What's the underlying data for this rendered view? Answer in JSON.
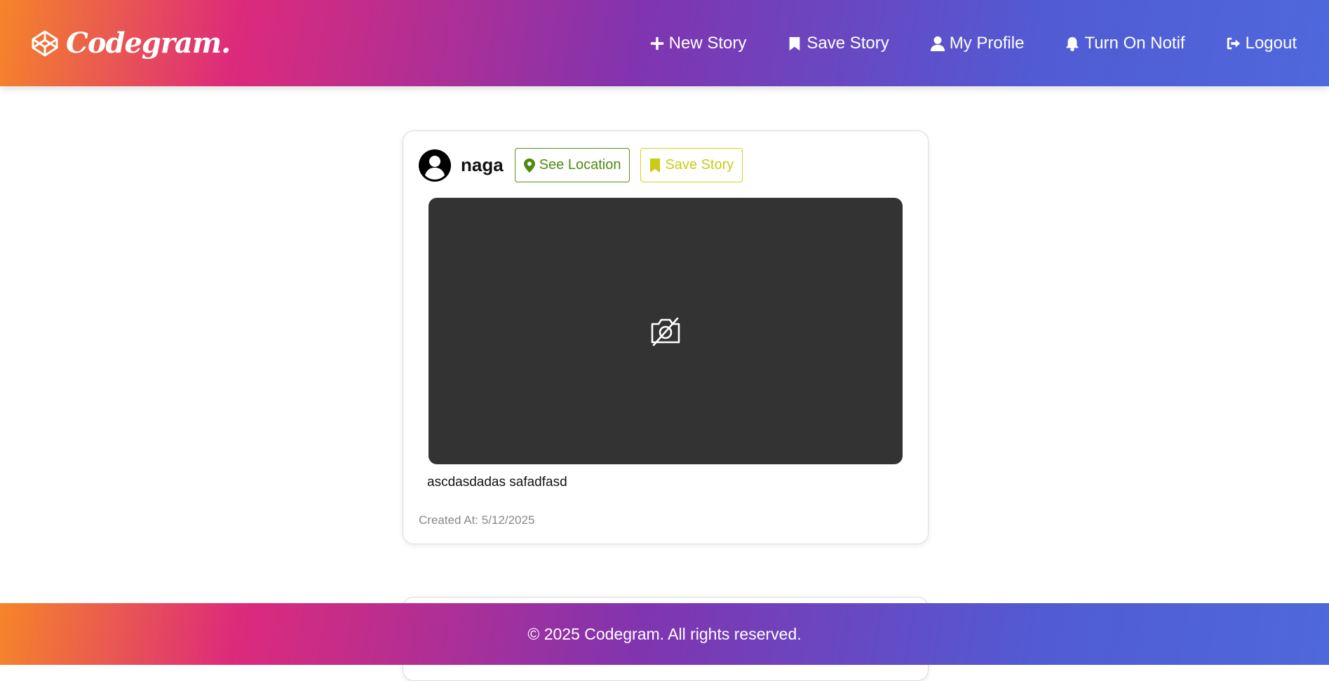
{
  "header": {
    "brand": "Codegram.",
    "links": [
      {
        "label": "New Story",
        "icon": "plus-icon"
      },
      {
        "label": "Save Story",
        "icon": "bookmark-icon"
      },
      {
        "label": "My Profile",
        "icon": "user-icon"
      },
      {
        "label": "Turn On Notif",
        "icon": "bell-icon"
      },
      {
        "label": "Logout",
        "icon": "logout-icon"
      }
    ]
  },
  "story": {
    "username": "naga",
    "location_button": "See Location",
    "save_button": "Save Story",
    "description": "ascdasdadas safadfasd",
    "created_at": "Created At: 5/12/2025"
  },
  "footer": {
    "text": "© 2025 Codegram. All rights reserved."
  },
  "colors": {
    "gradient": [
      "#f58529",
      "#dd2a7b",
      "#8134af",
      "#515bd4"
    ],
    "location_accent": "#4f8a10",
    "save_accent": "#c9cc12",
    "image_placeholder": "#333333"
  }
}
